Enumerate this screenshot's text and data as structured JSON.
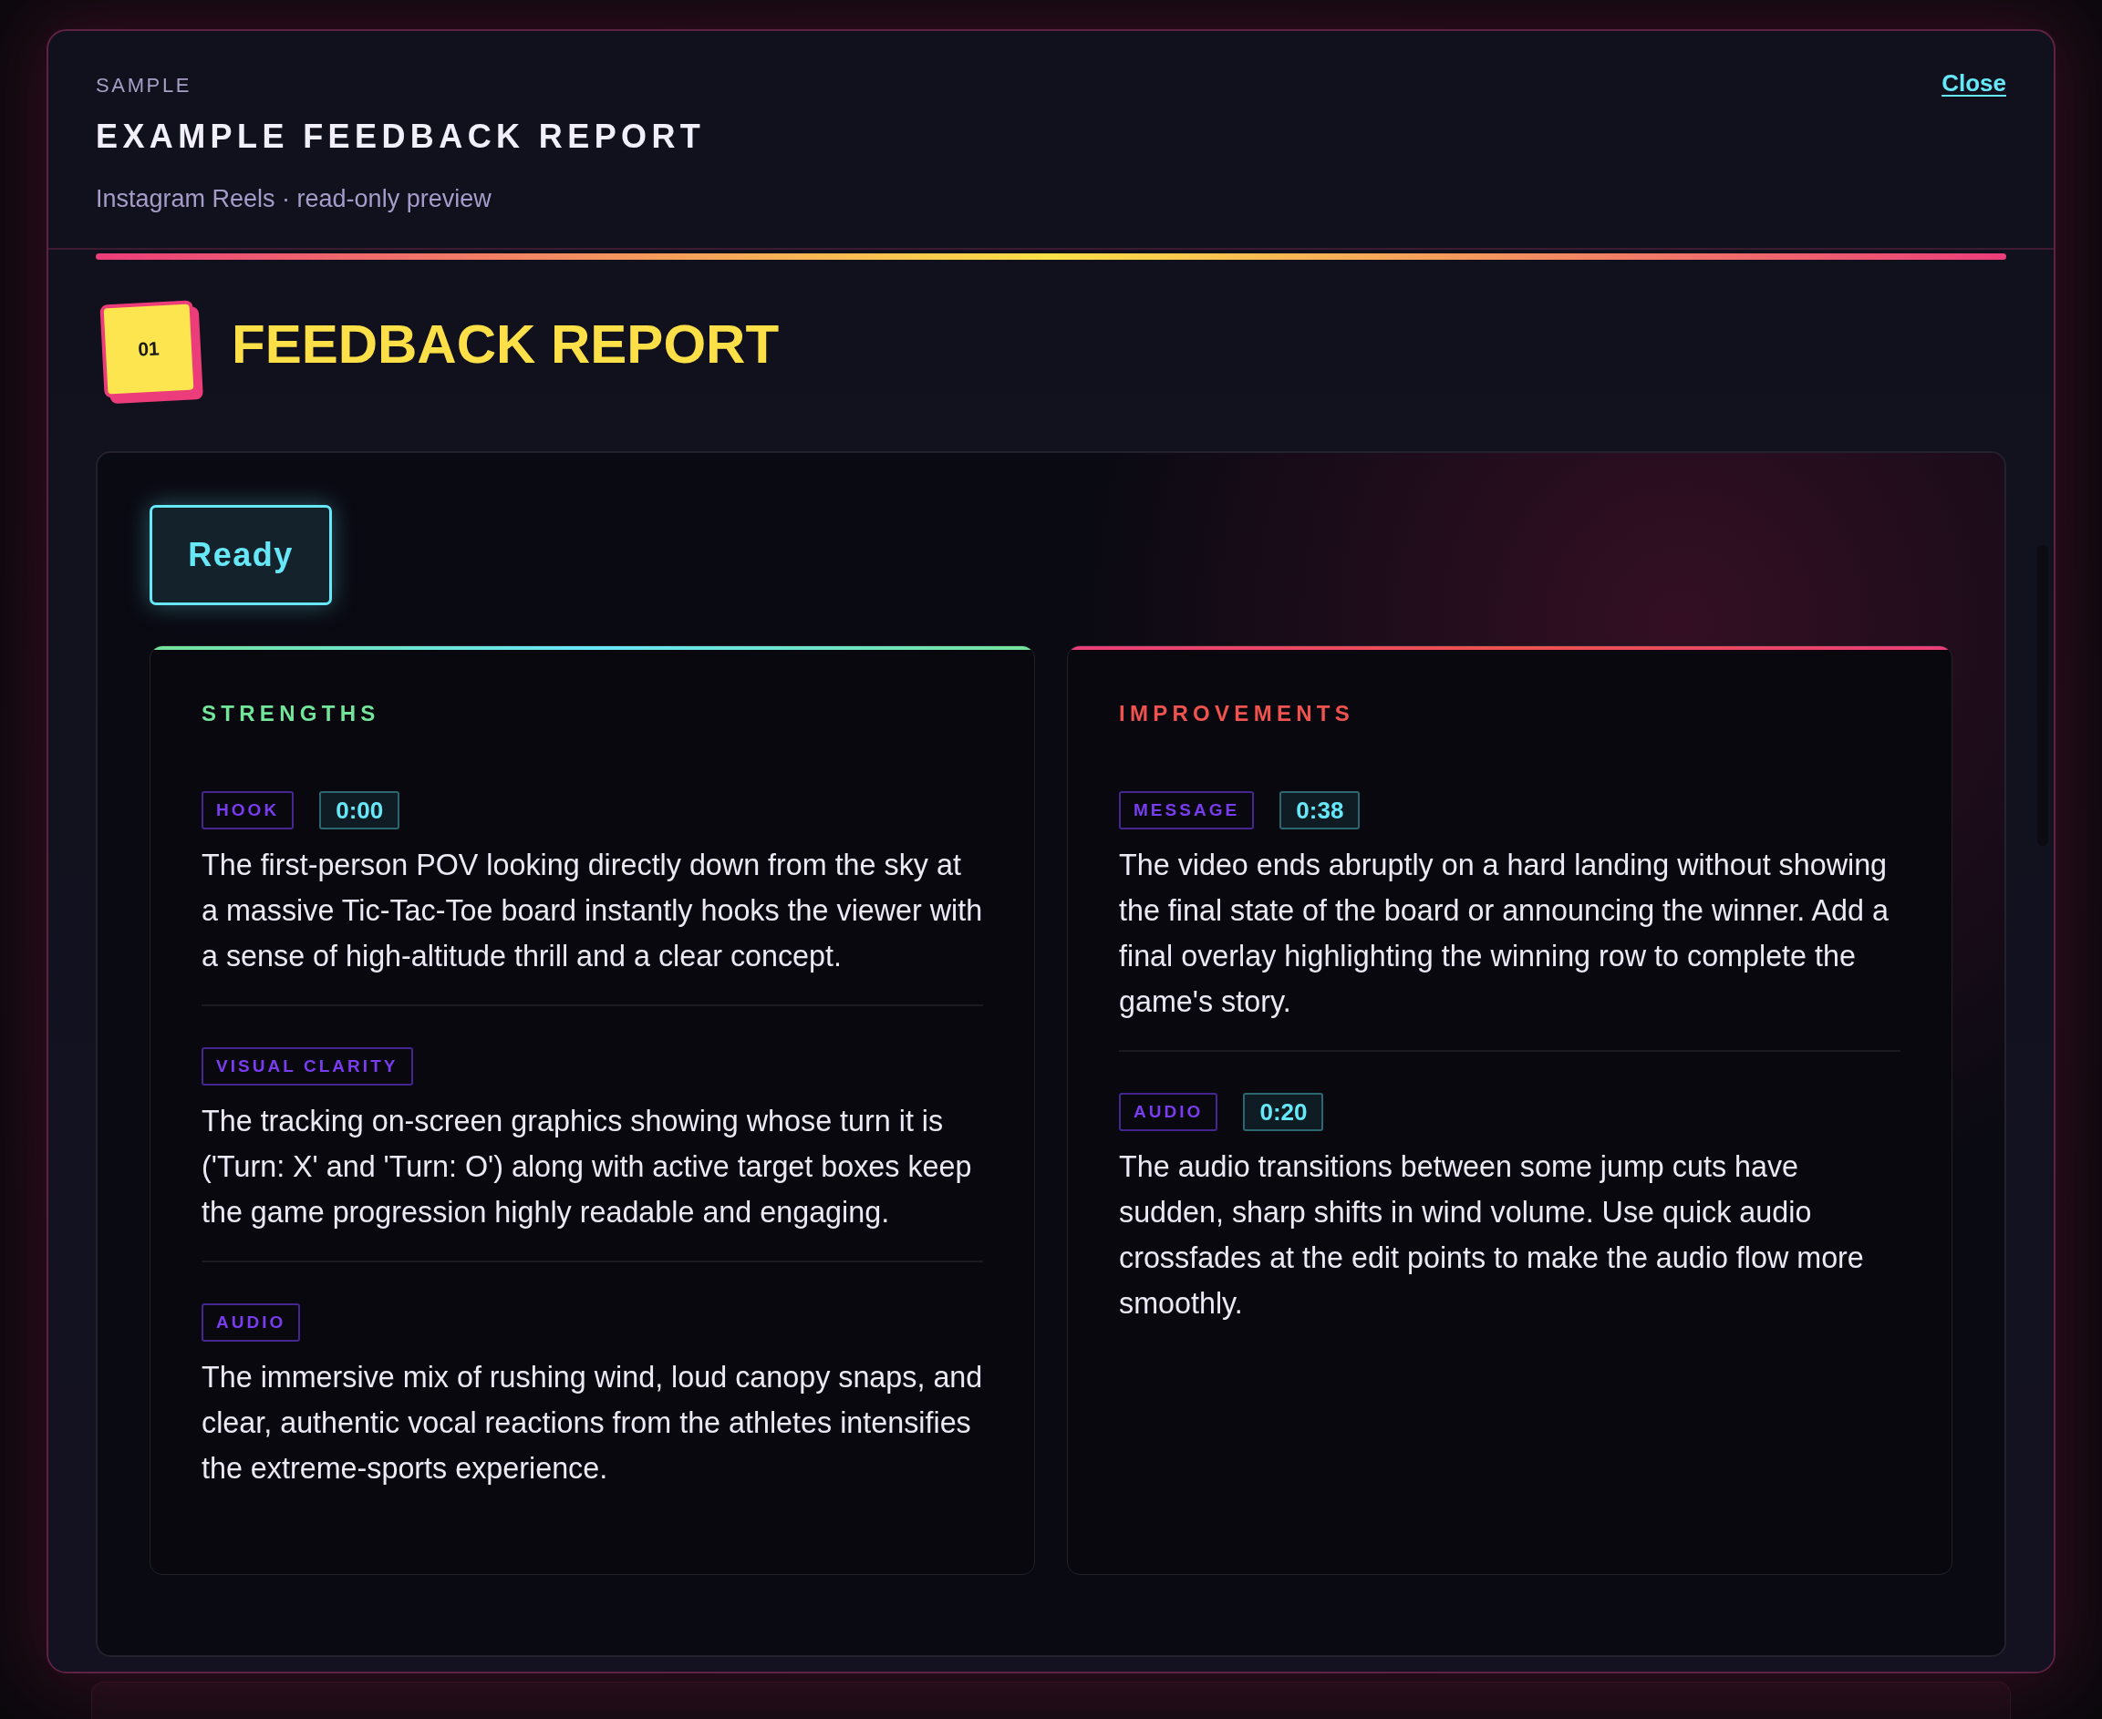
{
  "dialog": {
    "eyebrow": "SAMPLE",
    "title": "EXAMPLE FEEDBACK REPORT",
    "subtitle": "Instagram Reels · read-only preview",
    "close_link": "Close"
  },
  "section": {
    "number": "01",
    "title": "FEEDBACK REPORT"
  },
  "status": {
    "label": "Ready"
  },
  "panels": [
    {
      "kind": "strengths",
      "heading": "STRENGTHS",
      "items": [
        {
          "tag": "HOOK",
          "time": "0:00",
          "text": "The first-person POV looking directly down from the sky at a massive Tic-Tac-Toe board instantly hooks the viewer with a sense of high-altitude thrill and a clear concept."
        },
        {
          "tag": "VISUAL CLARITY",
          "text": "The tracking on-screen graphics showing whose turn it is ('Turn: X' and 'Turn: O') along with active target boxes keep the game progression highly readable and engaging."
        },
        {
          "tag": "AUDIO",
          "text": "The immersive mix of rushing wind, loud canopy snaps, and clear, authentic vocal reactions from the athletes intensifies the extreme-sports experience."
        }
      ]
    },
    {
      "kind": "improvements",
      "heading": "IMPROVEMENTS",
      "items": [
        {
          "tag": "MESSAGE",
          "time": "0:38",
          "text": "The video ends abruptly on a hard landing without showing the final state of the board or announcing the winner. Add a final overlay highlighting the winning row to complete the game's story."
        },
        {
          "tag": "AUDIO",
          "time": "0:20",
          "text": "The audio transitions between some jump cuts have sudden, sharp shifts in wind volume. Use quick audio crossfades at the edit points to make the audio flow more smoothly."
        }
      ]
    }
  ]
}
